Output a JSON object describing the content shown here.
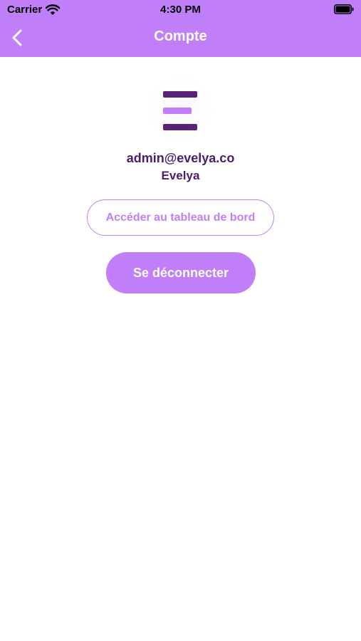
{
  "status_bar": {
    "carrier": "Carrier",
    "time": "4:30 PM",
    "wifi_icon": "wifi-icon",
    "battery_icon": "battery-full-icon"
  },
  "nav": {
    "title": "Compte",
    "back_icon": "chevron-left-icon"
  },
  "profile": {
    "logo_icon": "evelya-logo-icon",
    "email": "admin@evelya.co",
    "name": "Evelya"
  },
  "actions": {
    "dashboard_label": "Accéder au tableau de bord",
    "logout_label": "Se déconnecter"
  },
  "colors": {
    "accent": "#c07ff8",
    "dark_purple": "#4a1d6d",
    "logo_dark": "#5a2275",
    "logo_light": "#c07ff8",
    "background": "#ffffff"
  }
}
